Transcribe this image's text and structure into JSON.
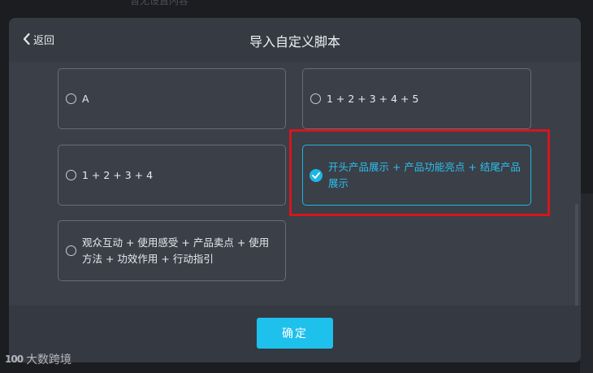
{
  "backdrop": {
    "partial_text": "暂无设置内容"
  },
  "dialog": {
    "back_label": "返回",
    "title": "导入自定义脚本",
    "options": [
      {
        "label": "A",
        "selected": false
      },
      {
        "label": "1 + 2 + 3 + 4 + 5",
        "selected": false
      },
      {
        "label": "1 + 2 + 3 + 4",
        "selected": false
      },
      {
        "label": "开头产品展示 + 产品功能亮点 + 结尾产品展示",
        "selected": true
      },
      {
        "label": "观众互动 + 使用感受 + 产品卖点 + 使用方法 + 功效作用 + 行动指引",
        "selected": false
      }
    ],
    "confirm_label": "确定"
  },
  "watermark": {
    "logo": "100",
    "text": "大数跨境"
  },
  "colors": {
    "accent": "#1ec0ec",
    "highlight": "#d4171c",
    "modal_bg": "#3b3f48",
    "header_bg": "#363a42"
  },
  "icons": {
    "back": "chevron-left-icon",
    "radio_unchecked": "radio-empty-icon",
    "radio_checked": "check-circle-icon"
  }
}
